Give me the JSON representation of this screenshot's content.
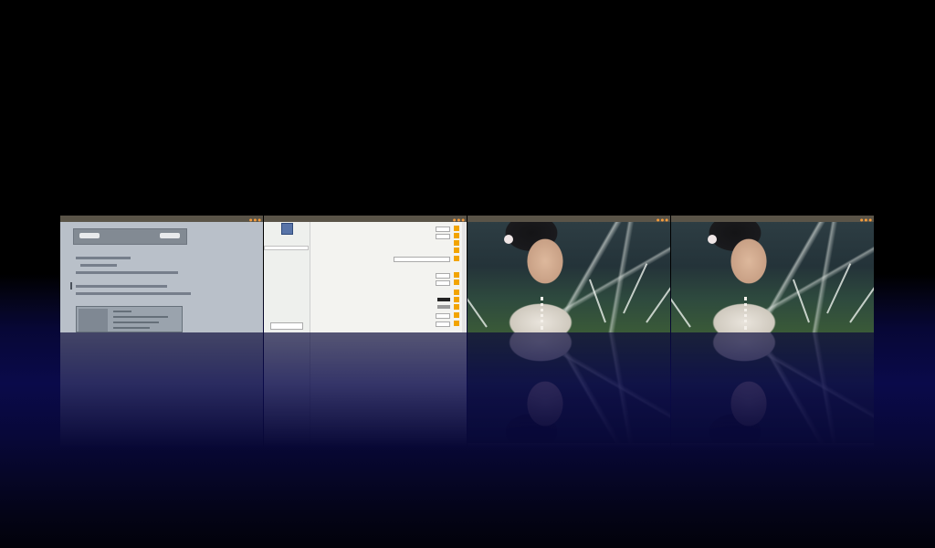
{
  "switcher": {
    "background": "#000000",
    "floor_color": "#0a0a4a",
    "windows": [
      {
        "title": "",
        "tabs": "",
        "content": "document",
        "panel_buttons": [
          "",
          ""
        ]
      },
      {
        "title": "",
        "tabs": "",
        "content": "preferences",
        "nav_items": [
          "",
          "",
          "",
          "",
          ""
        ],
        "ok_label": ""
      },
      {
        "title": "",
        "tabs": "",
        "content": "photo"
      },
      {
        "title": "",
        "tabs": "",
        "content": "photo"
      }
    ]
  }
}
